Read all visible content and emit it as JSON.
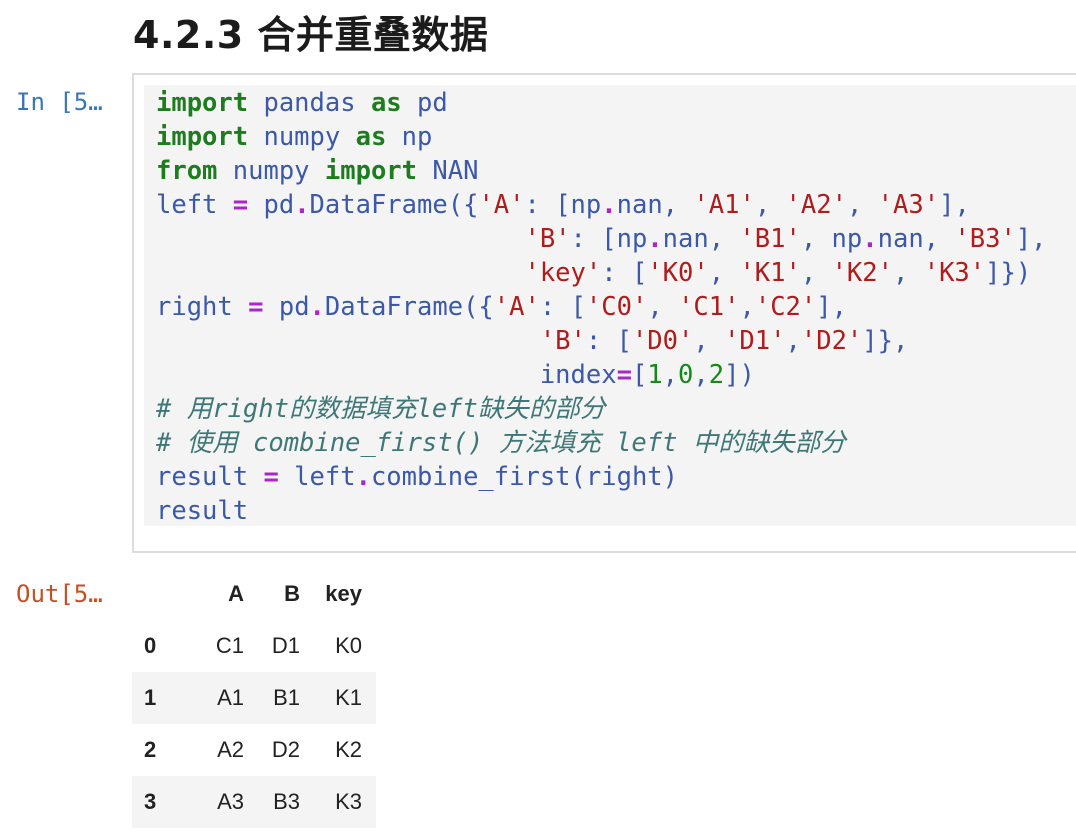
{
  "section_heading": "4.2.3 合并重叠数据",
  "input_prompt": "In [5…",
  "output_prompt": "Out[5…",
  "code": {
    "l1": {
      "kw1": "import",
      "mod": " pandas ",
      "kw2": "as",
      "alias": " pd"
    },
    "l2": {
      "kw1": "import",
      "mod": " numpy ",
      "kw2": "as",
      "alias": " np"
    },
    "l3": {
      "kw1": "from",
      "mod": " numpy ",
      "kw2": "import",
      "alias": " NAN"
    },
    "l4": {
      "a": "left ",
      "eq": "=",
      "b": " pd",
      "dot": ".",
      "c": "DataFrame({",
      "s1": "'A'",
      "d": ": [np",
      "dot2": ".",
      "e": "nan, ",
      "s2": "'A1'",
      "f": ", ",
      "s3": "'A2'",
      "g": ", ",
      "s4": "'A3'",
      "h": "],"
    },
    "l5": {
      "pad": "                        ",
      "s1": "'B'",
      "a": ": [np",
      "dot": ".",
      "b": "nan, ",
      "s2": "'B1'",
      "c": ", np",
      "dot2": ".",
      "d": "nan, ",
      "s3": "'B3'",
      "e": "],"
    },
    "l6": {
      "pad": "                        ",
      "s1": "'key'",
      "a": ": [",
      "s2": "'K0'",
      "b": ", ",
      "s3": "'K1'",
      "c": ", ",
      "s4": "'K2'",
      "d": ", ",
      "s5": "'K3'",
      "e": "]})"
    },
    "l7": {
      "a": "right ",
      "eq": "=",
      "b": " pd",
      "dot": ".",
      "c": "DataFrame({",
      "s1": "'A'",
      "d": ": [",
      "s2": "'C0'",
      "e": ", ",
      "s3": "'C1'",
      "f": ",",
      "s4": "'C2'",
      "g": "],"
    },
    "l8": {
      "pad": "                         ",
      "s1": "'B'",
      "a": ": [",
      "s2": "'D0'",
      "b": ", ",
      "s3": "'D1'",
      "c": ",",
      "s4": "'D2'",
      "d": "]},"
    },
    "l9": {
      "pad": "                         ",
      "a": "index",
      "eq": "=",
      "b": "[",
      "n1": "1",
      "c": ",",
      "n2": "0",
      "d": ",",
      "n3": "2",
      "e": "])"
    },
    "l10": "# 用right的数据填充left缺失的部分",
    "l11": "# 使用 combine_first() 方法填充 left 中的缺失部分",
    "l12": {
      "a": "result ",
      "eq": "=",
      "b": " left",
      "dot": ".",
      "c": "combine_first(right)"
    },
    "l13": "result"
  },
  "dataframe": {
    "columns": [
      "",
      "A",
      "B",
      "key"
    ],
    "rows": [
      {
        "index": "0",
        "A": "C1",
        "B": "D1",
        "key": "K0"
      },
      {
        "index": "1",
        "A": "A1",
        "B": "B1",
        "key": "K1"
      },
      {
        "index": "2",
        "A": "A2",
        "B": "D2",
        "key": "K2"
      },
      {
        "index": "3",
        "A": "A3",
        "B": "B3",
        "key": "K3"
      }
    ]
  }
}
